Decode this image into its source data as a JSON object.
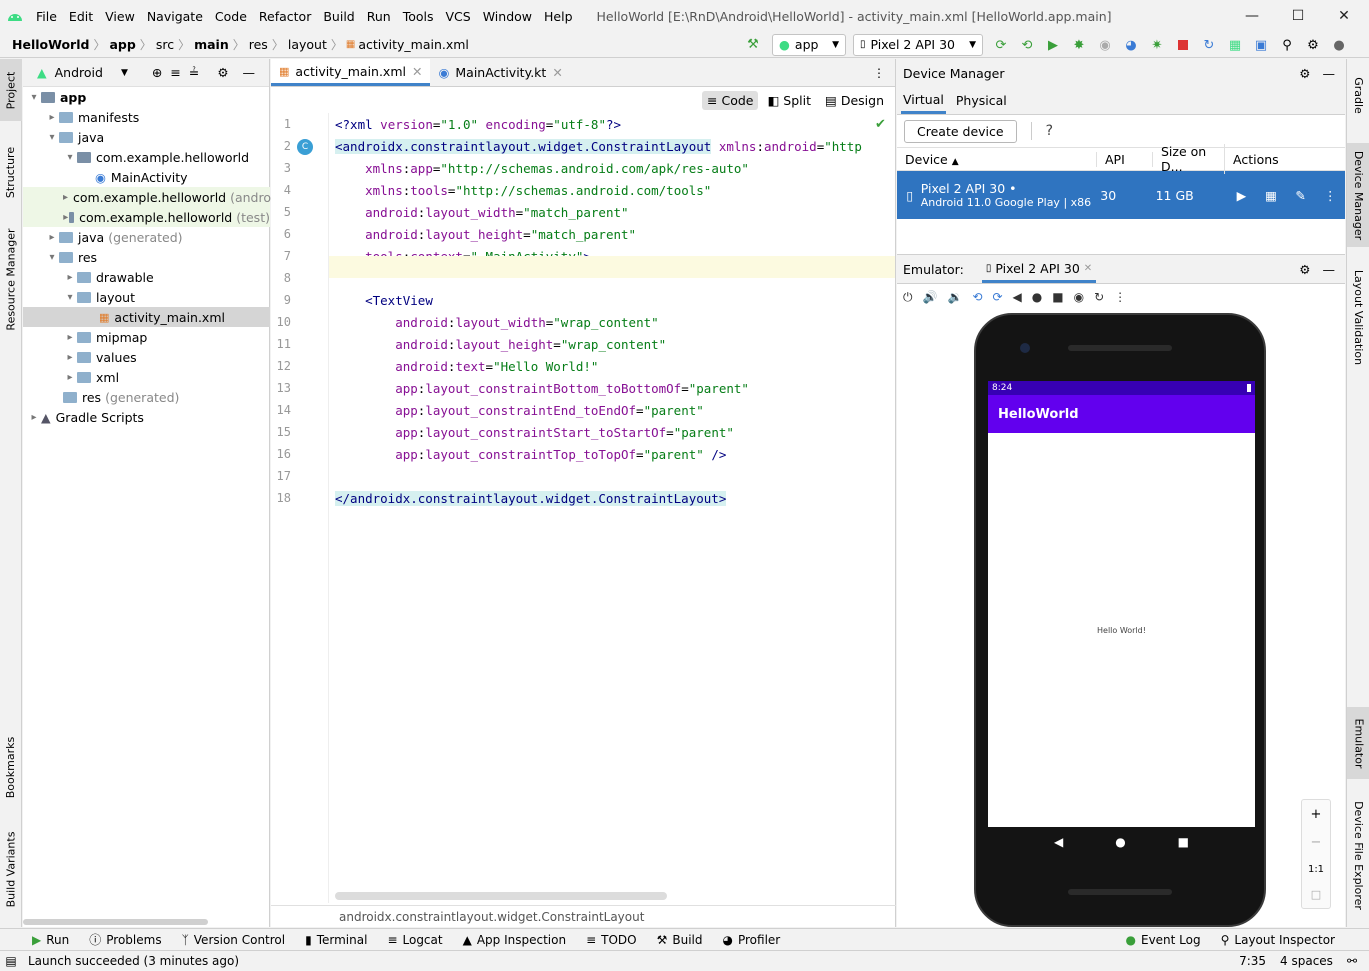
{
  "menubar": {
    "items": [
      "File",
      "Edit",
      "View",
      "Navigate",
      "Code",
      "Refactor",
      "Build",
      "Run",
      "Tools",
      "VCS",
      "Window",
      "Help"
    ],
    "window_title": "HelloWorld [E:\\RnD\\Android\\HelloWorld] - activity_main.xml [HelloWorld.app.main]"
  },
  "navbar": {
    "breadcrumbs": [
      "HelloWorld",
      "app",
      "src",
      "main",
      "res",
      "layout",
      "activity_main.xml"
    ],
    "run_config": "app",
    "device": "Pixel 2 API 30"
  },
  "left_stripe": {
    "tabs": [
      "Project",
      "Structure",
      "Resource Manager",
      "Bookmarks",
      "Build Variants"
    ]
  },
  "project": {
    "view_label": "Android",
    "tree": [
      {
        "label": "app",
        "bold": true
      },
      {
        "label": "manifests"
      },
      {
        "label": "java"
      },
      {
        "label": "com.example.helloworld"
      },
      {
        "label": "MainActivity"
      },
      {
        "label": "com.example.helloworld",
        "suffix": "(andro"
      },
      {
        "label": "com.example.helloworld",
        "suffix": "(test)"
      },
      {
        "label": "java",
        "suffix": "(generated)"
      },
      {
        "label": "res"
      },
      {
        "label": "drawable"
      },
      {
        "label": "layout"
      },
      {
        "label": "activity_main.xml"
      },
      {
        "label": "mipmap"
      },
      {
        "label": "values"
      },
      {
        "label": "xml"
      },
      {
        "label": "res",
        "suffix": "(generated)"
      },
      {
        "label": "Gradle Scripts"
      }
    ]
  },
  "editor": {
    "tabs": [
      "activity_main.xml",
      "MainActivity.kt"
    ],
    "modes": [
      "Code",
      "Split",
      "Design"
    ],
    "line_numbers": [
      "1",
      "2",
      "3",
      "4",
      "5",
      "6",
      "7",
      "8",
      "9",
      "10",
      "11",
      "12",
      "13",
      "14",
      "15",
      "16",
      "17",
      "18"
    ],
    "lines": [
      "<?xml version=\"1.0\" encoding=\"utf-8\"?>",
      "<androidx.constraintlayout.widget.ConstraintLayout xmlns:android=\"http",
      "    xmlns:app=\"http://schemas.android.com/apk/res-auto\"",
      "    xmlns:tools=\"http://schemas.android.com/tools\"",
      "    android:layout_width=\"match_parent\"",
      "    android:layout_height=\"match_parent\"",
      "    tools:context=\".MainActivity\">",
      "",
      "    <TextView",
      "        android:layout_width=\"wrap_content\"",
      "        android:layout_height=\"wrap_content\"",
      "        android:text=\"Hello World!\"",
      "        app:layout_constraintBottom_toBottomOf=\"parent\"",
      "        app:layout_constraintEnd_toEndOf=\"parent\"",
      "        app:layout_constraintStart_toStartOf=\"parent\"",
      "        app:layout_constraintTop_toTopOf=\"parent\" />",
      "",
      "</androidx.constraintlayout.widget.ConstraintLayout>"
    ],
    "footer": "androidx.constraintlayout.widget.ConstraintLayout"
  },
  "device_manager": {
    "title": "Device Manager",
    "tabs": [
      "Virtual",
      "Physical"
    ],
    "create_label": "Create device",
    "help": "?",
    "columns": [
      "Device",
      "API",
      "Size on D...",
      "Actions"
    ],
    "device": {
      "name": "Pixel 2 API 30",
      "sub": "Android 11.0 Google Play | x86",
      "api": "30",
      "size": "11 GB"
    }
  },
  "emulator": {
    "label": "Emulator:",
    "tab": "Pixel 2 API 30",
    "time": "8:24",
    "app_title": "HelloWorld",
    "content_text": "Hello World!",
    "zoom_ratio": "1:1"
  },
  "right_stripe": {
    "tabs": [
      "Gradle",
      "Device Manager",
      "Layout Validation",
      "Emulator",
      "Device File Explorer"
    ]
  },
  "bottom_tools": [
    "Run",
    "Problems",
    "Version Control",
    "Terminal",
    "Logcat",
    "App Inspection",
    "TODO",
    "Build",
    "Profiler"
  ],
  "bottom_right": [
    "Event Log",
    "Layout Inspector"
  ],
  "status": {
    "message": "Launch succeeded (3 minutes ago)",
    "position": "7:35",
    "indent": "4 spaces"
  },
  "colors": {
    "accent": "#4083c9",
    "selection": "#2f74c0",
    "app_bar": "#6200ee",
    "status_bar": "#3700b3"
  }
}
